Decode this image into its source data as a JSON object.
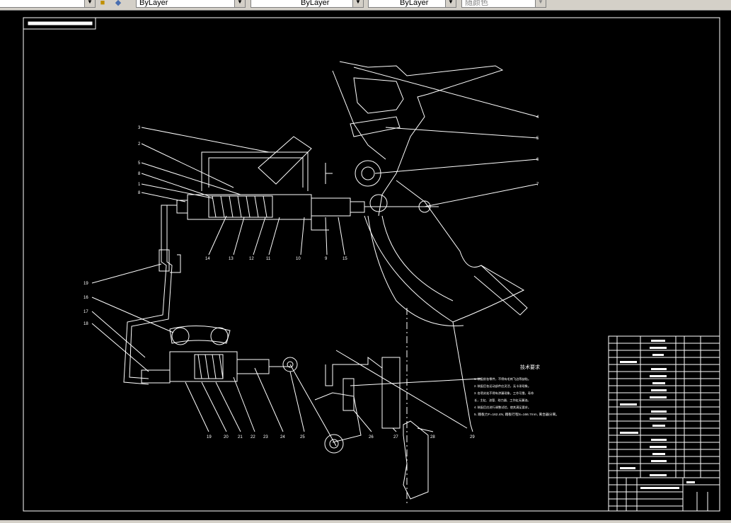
{
  "toolbar": {
    "color_combo": "ByLayer",
    "linetype_combo": "ByLayer",
    "lineweight_combo": "ByLayer",
    "plotstyle_combo": "随颜色",
    "dropdown_glyph": "▼"
  },
  "drawing": {
    "tech_title": "技术要求",
    "notes": [
      "1. 装配前各零件，不得有毛刺飞边等缺陷。",
      "2. 装配后各运动部件应灵活，无卡滞现象。",
      "3. 各密封处不得有渗漏现象，工作可靠，寿命",
      "长，主缸、油管、助力器、工作缸无漏油。",
      "4. 装配后应进行调整试验，使其满足要求。",
      "5. 踏板力F=162.4N, 踏板行程S=166.7mm, 离合器分离。"
    ],
    "part_labels": [
      "1",
      "2",
      "3",
      "4",
      "5",
      "6",
      "7",
      "8",
      "9",
      "10",
      "11",
      "12",
      "13",
      "14",
      "15",
      "16",
      "17",
      "18",
      "19",
      "20",
      "21",
      "22",
      "23",
      "24",
      "25",
      "26",
      "27",
      "28",
      "29"
    ],
    "colors": {
      "background": "#000000",
      "line": "#ffffff",
      "toolbar": "#d4d0c8"
    }
  }
}
